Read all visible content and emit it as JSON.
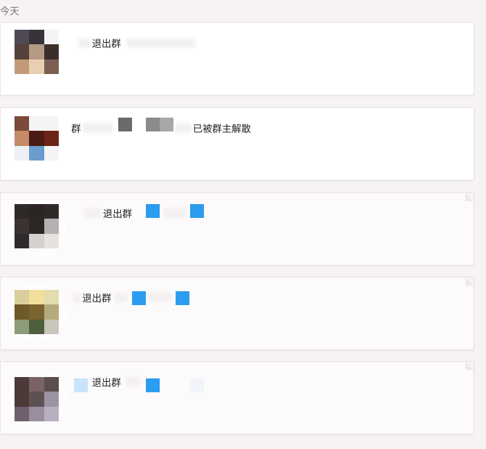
{
  "date_label": "今天",
  "cards": [
    {
      "text": "退出群"
    },
    {
      "text_prefix": "群",
      "text_suffix": "已被群主解散"
    },
    {
      "text": "退出群"
    },
    {
      "text": "退出群"
    },
    {
      "text": "退出群"
    }
  ],
  "watermark": ""
}
